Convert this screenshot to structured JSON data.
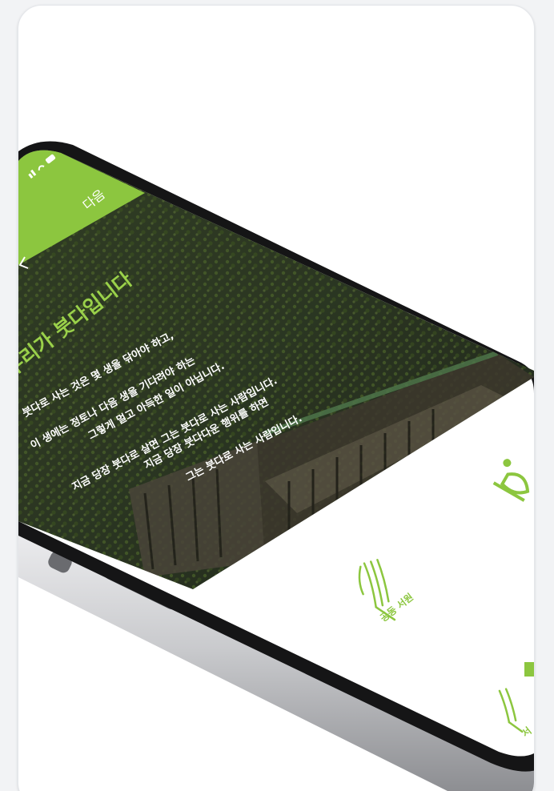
{
  "promo": {
    "status_bar": {
      "icons": [
        "signal-icon",
        "wifi-icon",
        "battery-icon"
      ]
    },
    "header": {
      "next_label": "다음",
      "back_icon": "back-arrow-icon"
    },
    "hero": {
      "title": "우리가 붓다입니다",
      "lines": [
        "붓다로 사는 것은 몇 생을 닦아야 하고,",
        "이 생에는 정토나 다음 생을 기다려야 하는",
        "그렇게 멀고 아득한 일이 아닙니다.",
        "지금 당장 붓다로 살면 그는 붓다로 사는 사람입니다.",
        "지금 당장 붓다다운 행위를 하면",
        "그는 붓다로 사는 사람입니다."
      ]
    },
    "menu": {
      "items": [
        {
          "label": "공동 서원",
          "icon": "praying-hands-icon"
        },
        {
          "label": "",
          "icon": "meditation-figure-icon"
        },
        {
          "label": "서",
          "icon": "praying-hands-icon"
        }
      ]
    },
    "colors": {
      "accent": "#8cc63f",
      "photo_dark": "#2f3b26",
      "phone_frame": "#1c1c1e",
      "phone_side": "#d9dadc"
    }
  }
}
